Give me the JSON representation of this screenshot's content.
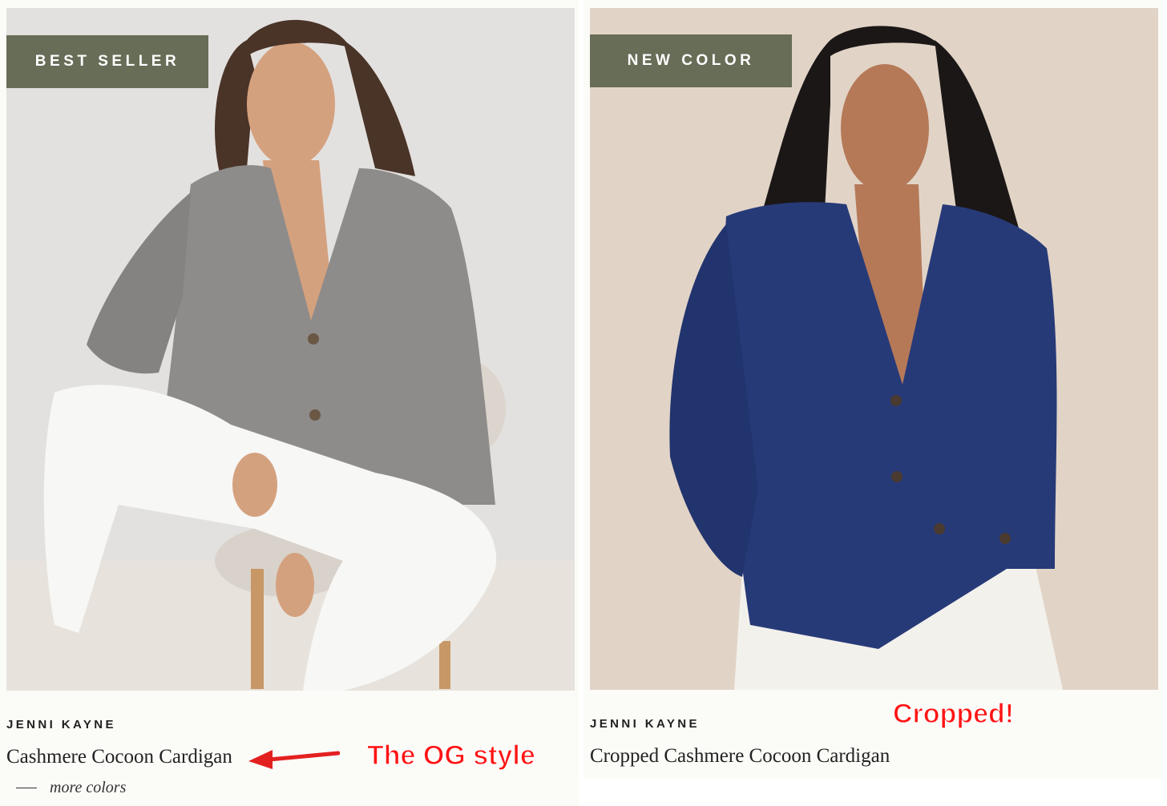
{
  "products": [
    {
      "badge": "BEST SELLER",
      "brand": "JENNI KAYNE",
      "title": "Cashmere Cocoon Cardigan",
      "more_colors": "more colors",
      "image_colors": {
        "background": "#e3e1df",
        "floor": "#e7e3dc",
        "sweater": "#8e8c8a",
        "pants": "#f7f7f5",
        "hair": "#4a3327",
        "skin": "#d4a17f",
        "stool": "#d9d2ca"
      }
    },
    {
      "badge": "NEW COLOR",
      "brand": "JENNI KAYNE",
      "title": "Cropped Cashmere Cocoon Cardigan",
      "image_colors": {
        "background": "#e1d4c7",
        "sweater": "#273a78",
        "pants": "#f3f1ec",
        "hair": "#1b1716",
        "skin": "#b57958"
      }
    }
  ],
  "annotations": {
    "og_label": "The OG style",
    "cropped_label": "Cropped!",
    "arrow_color": "#e32020"
  },
  "colors": {
    "badge_bg": "#686d57",
    "annotation_red": "#ff1414"
  }
}
